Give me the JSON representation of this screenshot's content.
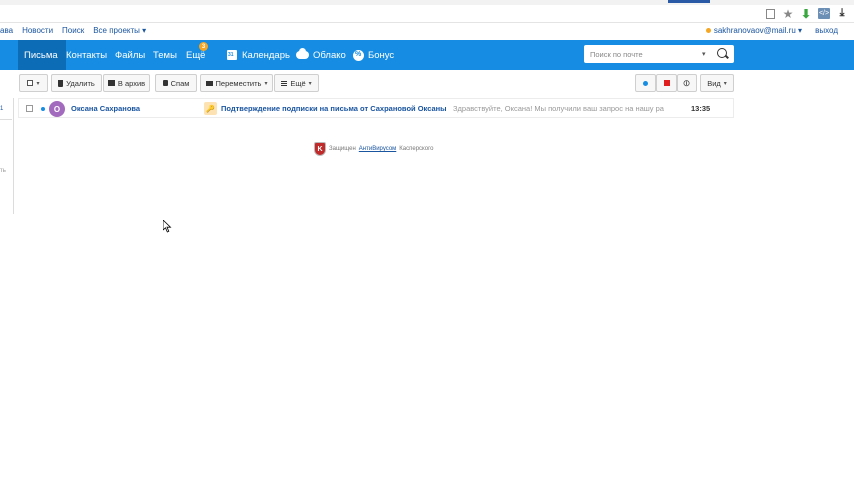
{
  "portal": {
    "links": [
      "ава",
      "Новости",
      "Поиск",
      "Все проекты ▾"
    ],
    "user_email": "sakhranovaov@mail.ru ▾",
    "logout": "выход"
  },
  "nav": {
    "items": [
      {
        "label": "Письма"
      },
      {
        "label": "Контакты"
      },
      {
        "label": "Файлы"
      },
      {
        "label": "Темы"
      },
      {
        "label": "Ещё"
      },
      {
        "label": "Календарь"
      },
      {
        "label": "Облако"
      },
      {
        "label": "Бонус"
      }
    ],
    "more_badge": "3",
    "search_placeholder": "Поиск по почте"
  },
  "toolbar": {
    "delete": "Удалить",
    "archive": "В архив",
    "spam": "Спам",
    "move": "Переместить",
    "more": "Ещё",
    "view": "Вид"
  },
  "left_pane": {
    "count": "1",
    "fragment": "ть"
  },
  "messages": [
    {
      "avatar": "О",
      "sender": "Оксана Сахранова",
      "subject": "Подтверждение подписки на письма от Сахрановой Оксаны",
      "snippet": "Здравствуйте, Оксана! Мы получили ваш запрос на нашу ра",
      "time": "13:35"
    }
  ],
  "protection": {
    "prefix": "Защищен",
    "link": "АнтиВирусом",
    "suffix": "Касперского"
  },
  "colors": {
    "nav_bg": "#168de2",
    "nav_active": "#0d6cb6",
    "link": "#1a55a0",
    "badge": "#f6a623"
  }
}
